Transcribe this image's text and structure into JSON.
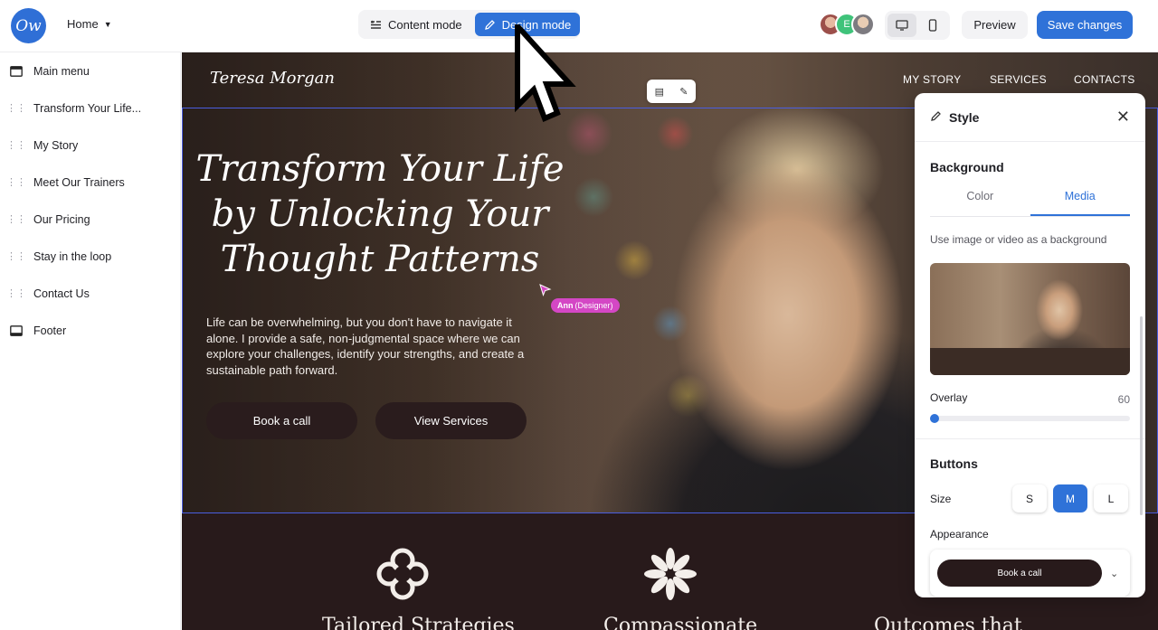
{
  "topbar": {
    "logo_text": "Ow",
    "page_selector": "Home",
    "modes": [
      {
        "label": "Content mode",
        "active": false
      },
      {
        "label": "Design mode",
        "active": true
      }
    ],
    "collaborator_initial": "E",
    "preview_label": "Preview",
    "save_label": "Save changes"
  },
  "sidebar": {
    "items": [
      {
        "label": "Main menu",
        "icon": "header-icon"
      },
      {
        "label": "Transform Your Life...",
        "icon": "drag-handle-icon"
      },
      {
        "label": "My Story",
        "icon": "drag-handle-icon"
      },
      {
        "label": "Meet Our Trainers",
        "icon": "drag-handle-icon"
      },
      {
        "label": "Our Pricing",
        "icon": "drag-handle-icon"
      },
      {
        "label": "Stay in the loop",
        "icon": "drag-handle-icon"
      },
      {
        "label": "Contact Us",
        "icon": "drag-handle-icon"
      },
      {
        "label": "Footer",
        "icon": "footer-icon"
      }
    ]
  },
  "site": {
    "brand": "Teresa Morgan",
    "nav": [
      "MY STORY",
      "SERVICES",
      "CONTACTS"
    ],
    "hero_title_lines": [
      "Transform Your Life",
      "by Unlocking Your",
      "Thought Patterns"
    ],
    "hero_text": "Life can be overwhelming, but you don't have to navigate it alone. I provide a safe, non-judgmental space where we can explore your challenges, identify your strengths, and create a sustainable path forward.",
    "buttons": [
      "Book a call",
      "View Services"
    ],
    "collaborator_tag": {
      "name": "Ann",
      "role": "(Designer)"
    },
    "features": [
      "Tailored Strategies",
      "Compassionate",
      "Outcomes that"
    ]
  },
  "style_panel": {
    "title": "Style",
    "background_heading": "Background",
    "tabs": [
      {
        "label": "Color",
        "active": false
      },
      {
        "label": "Media",
        "active": true
      }
    ],
    "help_text": "Use image or video as a background",
    "overlay_label": "Overlay",
    "overlay_value": "60",
    "buttons_heading": "Buttons",
    "size_label": "Size",
    "sizes": [
      {
        "label": "S",
        "active": false
      },
      {
        "label": "M",
        "active": true
      },
      {
        "label": "L",
        "active": false
      }
    ],
    "appearance_label": "Appearance",
    "appearance_preview": "Book a call"
  },
  "colors": {
    "accent": "#2f72d8",
    "hero_button": "#2a1c1d",
    "collab_tag": "#d447c5",
    "selection_outline": "#4a5ee0"
  }
}
